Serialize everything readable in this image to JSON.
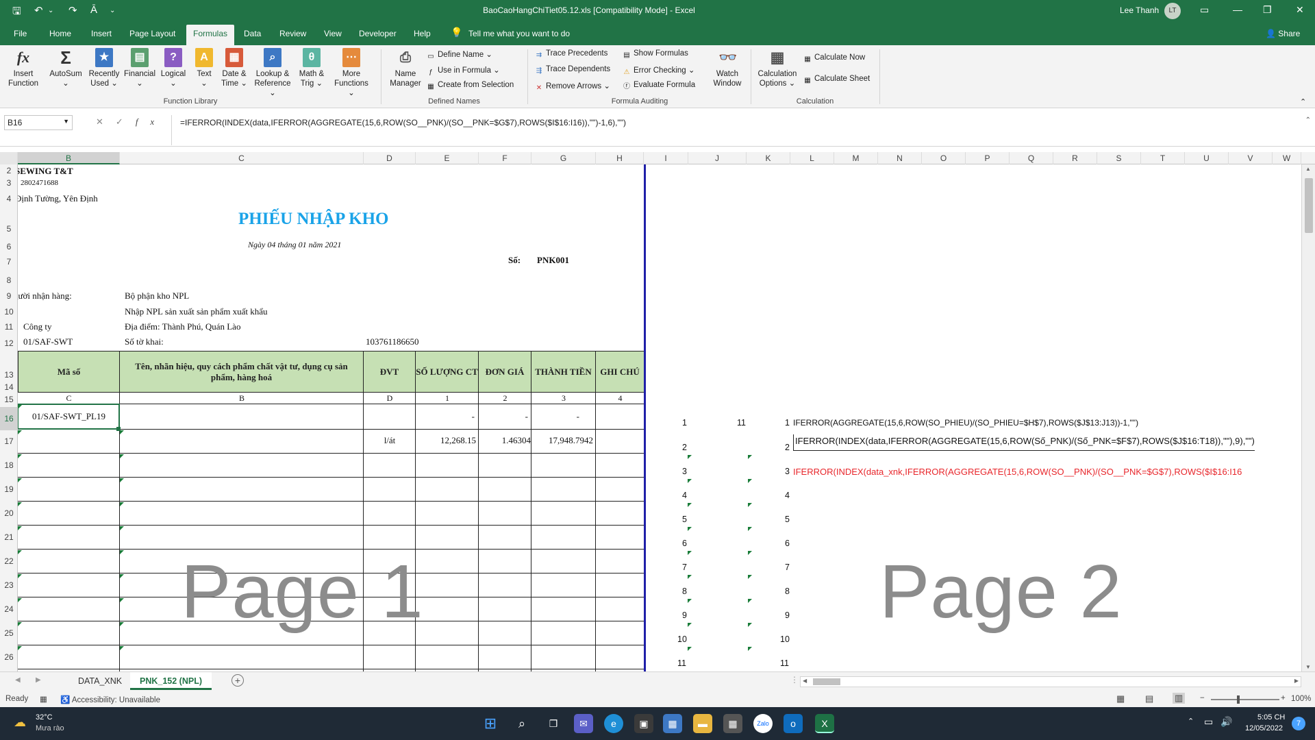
{
  "titlebar": {
    "title": "BaoCaoHangChiTiet05.12.xls  [Compatibility Mode]  -  Excel",
    "user": "Lee Thanh",
    "avatar": "LT"
  },
  "menu": {
    "tabs": [
      "File",
      "Home",
      "Insert",
      "Page Layout",
      "Formulas",
      "Data",
      "Review",
      "View",
      "Developer",
      "Help"
    ],
    "active": "Formulas",
    "tell_me": "Tell me what you want to do",
    "share": "Share"
  },
  "ribbon": {
    "function_library": {
      "label": "Function Library",
      "insert_function": [
        "Insert",
        "Function"
      ],
      "autosum": [
        "AutoSum",
        "⌄"
      ],
      "recently_used": [
        "Recently",
        "Used ⌄"
      ],
      "financial": [
        "Financial",
        "⌄"
      ],
      "logical": [
        "Logical",
        "⌄"
      ],
      "text": [
        "Text",
        "⌄"
      ],
      "date_time": [
        "Date &",
        "Time ⌄"
      ],
      "lookup": [
        "Lookup &",
        "Reference ⌄"
      ],
      "math": [
        "Math &",
        "Trig ⌄"
      ],
      "more": [
        "More",
        "Functions ⌄"
      ]
    },
    "defined_names": {
      "label": "Defined Names",
      "name_manager": [
        "Name",
        "Manager"
      ],
      "define_name": "Define Name ⌄",
      "use_in_formula": "Use in Formula ⌄",
      "create_from_selection": "Create from Selection"
    },
    "formula_auditing": {
      "label": "Formula Auditing",
      "trace_precedents": "Trace Precedents",
      "trace_dependents": "Trace Dependents",
      "remove_arrows": "Remove Arrows ⌄",
      "show_formulas": "Show Formulas",
      "error_checking": "Error Checking ⌄",
      "evaluate_formula": "Evaluate Formula",
      "watch_window": [
        "Watch",
        "Window"
      ]
    },
    "calculation": {
      "label": "Calculation",
      "options": [
        "Calculation",
        "Options ⌄"
      ],
      "calc_now": "Calculate Now",
      "calc_sheet": "Calculate Sheet"
    }
  },
  "formula_bar": {
    "name_box": "B16",
    "formula": "=IFERROR(INDEX(data,IFERROR(AGGREGATE(15,6,ROW(SO__PNK)/(SO__PNK=$G$7),ROWS($I$16:I16)),\"\")-1,6),\"\")"
  },
  "columns": [
    "B",
    "C",
    "D",
    "E",
    "F",
    "G",
    "H",
    "I",
    "J",
    "K",
    "L",
    "M",
    "N",
    "O",
    "P",
    "Q",
    "R",
    "S",
    "T",
    "U",
    "V",
    "W"
  ],
  "rows": [
    "2",
    "3",
    "4",
    "5",
    "6",
    "7",
    "8",
    "9",
    "10",
    "11",
    "12",
    "13",
    "14",
    "15",
    "16",
    "17",
    "18",
    "19",
    "20",
    "21",
    "22",
    "23",
    "24",
    "25",
    "26"
  ],
  "sheet": {
    "company": "SEWING T&T",
    "tax_code": "2802471688",
    "address": "Định Tường, Yên Định",
    "doc_title": "PHIẾU NHẬP KHO",
    "doc_date": "Ngày 04 tháng 01 năm 2021",
    "so_label": "Số:",
    "so_value": "PNK001",
    "receiver_label": "gười nhận hàng:",
    "receiver_value": "Bộ phận kho NPL",
    "reason": "Nhập NPL sản xuất sản phẩm xuất khẩu",
    "company_label": "Công ty",
    "location": "Địa điểm:  Thành Phú, Quán Lào",
    "contract": "01/SAF-SWT",
    "declaration_label": "Số tờ khai:",
    "declaration_value": "103761186650",
    "table_headers": [
      "Mã số",
      "Tên, nhãn hiệu, quy cách phẩm chất vật tư, dụng cụ sản phẩm, hàng hoá",
      "ĐVT",
      "SỐ LƯỢNG CT",
      "ĐƠN GIÁ",
      "THÀNH TIỀN",
      "GHI CHÚ"
    ],
    "col_codes": [
      "C",
      "B",
      "D",
      "1",
      "2",
      "3",
      "4"
    ],
    "row16": [
      "01/SAF-SWT_PL19",
      "",
      "",
      "-",
      "-",
      "-",
      ""
    ],
    "row17": [
      "",
      "",
      "l/át",
      "12,268.15",
      "1.46304",
      "17,948.7942",
      ""
    ],
    "watermark1": "Page 1",
    "watermark2": "Page 2"
  },
  "page2": {
    "col_i": [
      "1",
      "2",
      "3",
      "4",
      "5",
      "6",
      "7",
      "8",
      "9",
      "10",
      "11"
    ],
    "j_first": "11",
    "col_k": [
      "1",
      "2",
      "3",
      "4",
      "5",
      "6",
      "7",
      "8",
      "9",
      "10",
      "11"
    ],
    "formula1": "IFERROR(AGGREGATE(15,6,ROW(SO_PHIEU)/(SO_PHIEU=$H$7),ROWS($J$13:J13))-1,\"\")",
    "formula2": "IFERROR(INDEX(data,IFERROR(AGGREGATE(15,6,ROW(Số_PNK)/(Số_PNK=$F$7),ROWS($J$16:T18)),\"\"),9),\"\")",
    "formula3": "IFERROR(INDEX(data_xnk,IFERROR(AGGREGATE(15,6,ROW(SO__PNK)/(SO__PNK=$G$7),ROWS($I$16:I16",
    "formula3_color": "#e8262b"
  },
  "sheet_tabs": [
    "DATA_XNK",
    "PNK_152 (NPL)"
  ],
  "active_sheet": "PNK_152 (NPL)",
  "status": {
    "ready": "Ready",
    "accessibility": "Accessibility: Unavailable",
    "zoom": "100%"
  },
  "taskbar": {
    "temperature": "32°C",
    "weather": "Mưa rào",
    "time": "5:05 CH",
    "date": "12/05/2022",
    "badge": "7"
  },
  "colors": {
    "accent": "#217346",
    "header_fill": "#c6e0b4",
    "title_blue": "#1aa3e8"
  }
}
